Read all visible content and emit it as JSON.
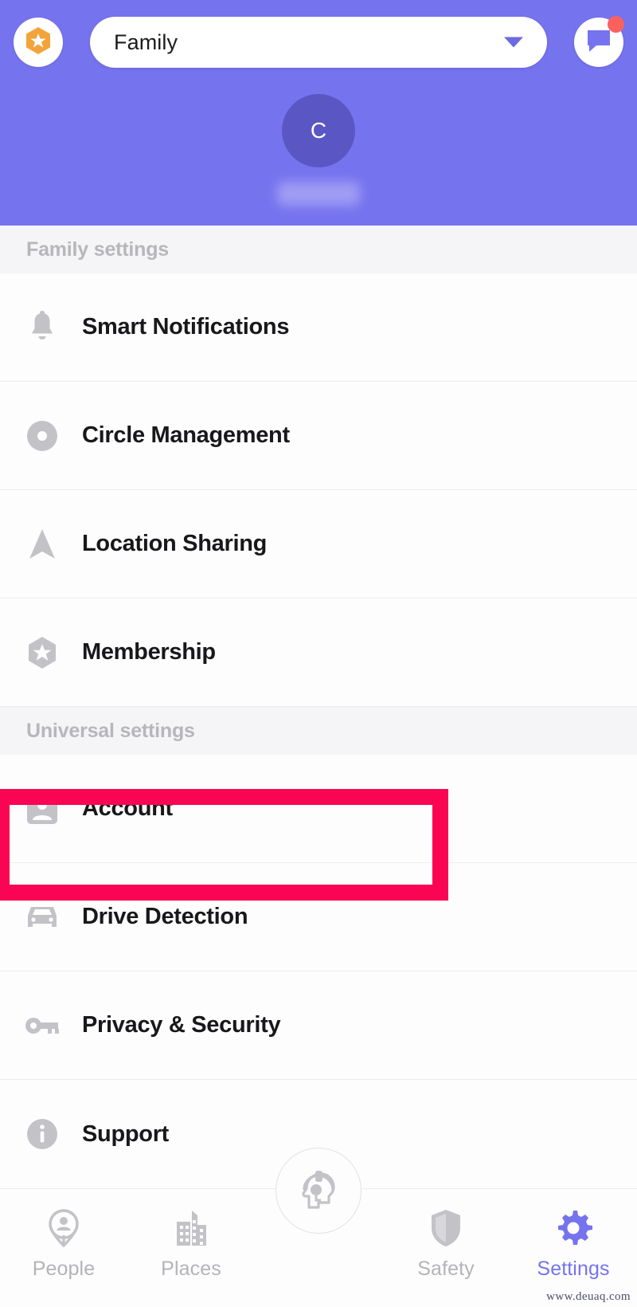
{
  "header": {
    "badge_icon": "hexagon-star-icon",
    "badge_color": "#f2a43a",
    "circle_selector": {
      "value": "Family",
      "caret_icon": "chevron-down-icon"
    },
    "messages_icon": "chat-bubble-icon",
    "has_unread_badge": true,
    "unread_badge_color": "#f9615f",
    "background_color": "#7673ef",
    "profile": {
      "avatar_initial": "C",
      "avatar_color": "#5a57c4",
      "name_redacted": true
    }
  },
  "sections": [
    {
      "title": "Family settings",
      "items": [
        {
          "label": "Smart Notifications",
          "icon": "bell-icon"
        },
        {
          "label": "Circle Management",
          "icon": "circle-dot-icon"
        },
        {
          "label": "Location Sharing",
          "icon": "navigation-arrow-icon"
        },
        {
          "label": "Membership",
          "icon": "hexagon-star-icon"
        }
      ]
    },
    {
      "title": "Universal settings",
      "items": [
        {
          "label": "Account",
          "icon": "person-card-icon",
          "highlighted": true
        },
        {
          "label": "Drive Detection",
          "icon": "car-icon"
        },
        {
          "label": "Privacy & Security",
          "icon": "key-icon"
        },
        {
          "label": "Support",
          "icon": "info-circle-icon"
        }
      ]
    }
  ],
  "highlight": {
    "target": "Account",
    "color": "#f90553"
  },
  "bottom_nav": {
    "items": [
      {
        "label": "People",
        "icon": "map-pin-person-icon",
        "active": false
      },
      {
        "label": "Places",
        "icon": "buildings-icon",
        "active": false
      },
      {
        "label": "Safety",
        "icon": "shield-icon",
        "active": false
      },
      {
        "label": "Settings",
        "icon": "gear-icon",
        "active": true
      }
    ],
    "center_button": {
      "icon": "sos-headset-head-icon",
      "label": ""
    },
    "active_color": "#7673ef",
    "inactive_color": "#b4b4b8"
  },
  "watermark": "www.deuaq.com"
}
